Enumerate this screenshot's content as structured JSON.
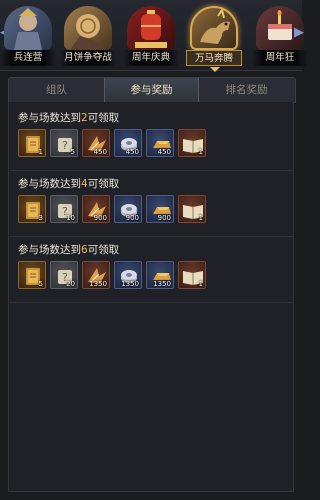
{
  "events": [
    {
      "label": "兵连营",
      "icon": "soldier-portrait-icon"
    },
    {
      "label": "月饼争夺战",
      "icon": "mooncake-battle-icon"
    },
    {
      "label": "周年庆典",
      "icon": "anniversary-lantern-icon"
    },
    {
      "label": "万马奔腾",
      "icon": "galloping-horses-icon",
      "selected": true
    },
    {
      "label": "周年狂",
      "icon": "anniversary-cake-icon"
    }
  ],
  "tabs": [
    {
      "label": "组队",
      "active": false
    },
    {
      "label": "参与奖励",
      "active": true
    },
    {
      "label": "排名奖励",
      "active": false
    }
  ],
  "rows": [
    {
      "title_prefix": "参与场数达到",
      "count": "2",
      "title_suffix": "可领取",
      "items": [
        {
          "icon": "scroll-book-icon",
          "qty": "1"
        },
        {
          "icon": "mystery-box-icon",
          "qty": "5"
        },
        {
          "icon": "exp-wing-icon",
          "qty": "450"
        },
        {
          "icon": "coin-stack-icon",
          "qty": "450"
        },
        {
          "icon": "gold-bar-icon",
          "qty": "450"
        },
        {
          "icon": "open-book-icon",
          "qty": "1"
        }
      ]
    },
    {
      "title_prefix": "参与场数达到",
      "count": "4",
      "title_suffix": "可领取",
      "items": [
        {
          "icon": "scroll-book-icon",
          "qty": "3"
        },
        {
          "icon": "mystery-box-icon",
          "qty": "10"
        },
        {
          "icon": "exp-wing-icon",
          "qty": "900"
        },
        {
          "icon": "coin-stack-icon",
          "qty": "900"
        },
        {
          "icon": "gold-bar-icon",
          "qty": "900"
        },
        {
          "icon": "open-book-icon",
          "qty": "1"
        }
      ]
    },
    {
      "title_prefix": "参与场数达到",
      "count": "6",
      "title_suffix": "可领取",
      "items": [
        {
          "icon": "scroll-book-icon",
          "qty": "5"
        },
        {
          "icon": "mystery-box-icon",
          "qty": "20"
        },
        {
          "icon": "exp-wing-icon",
          "qty": "1350"
        },
        {
          "icon": "coin-stack-icon",
          "qty": "1350"
        },
        {
          "icon": "gold-bar-icon",
          "qty": "1350"
        },
        {
          "icon": "open-book-icon",
          "qty": "1"
        }
      ]
    }
  ],
  "colors": {
    "count_highlight": "#f0b64a",
    "accent_gold": "#d9a84a",
    "nav_arrow": "#7c9ad8"
  }
}
